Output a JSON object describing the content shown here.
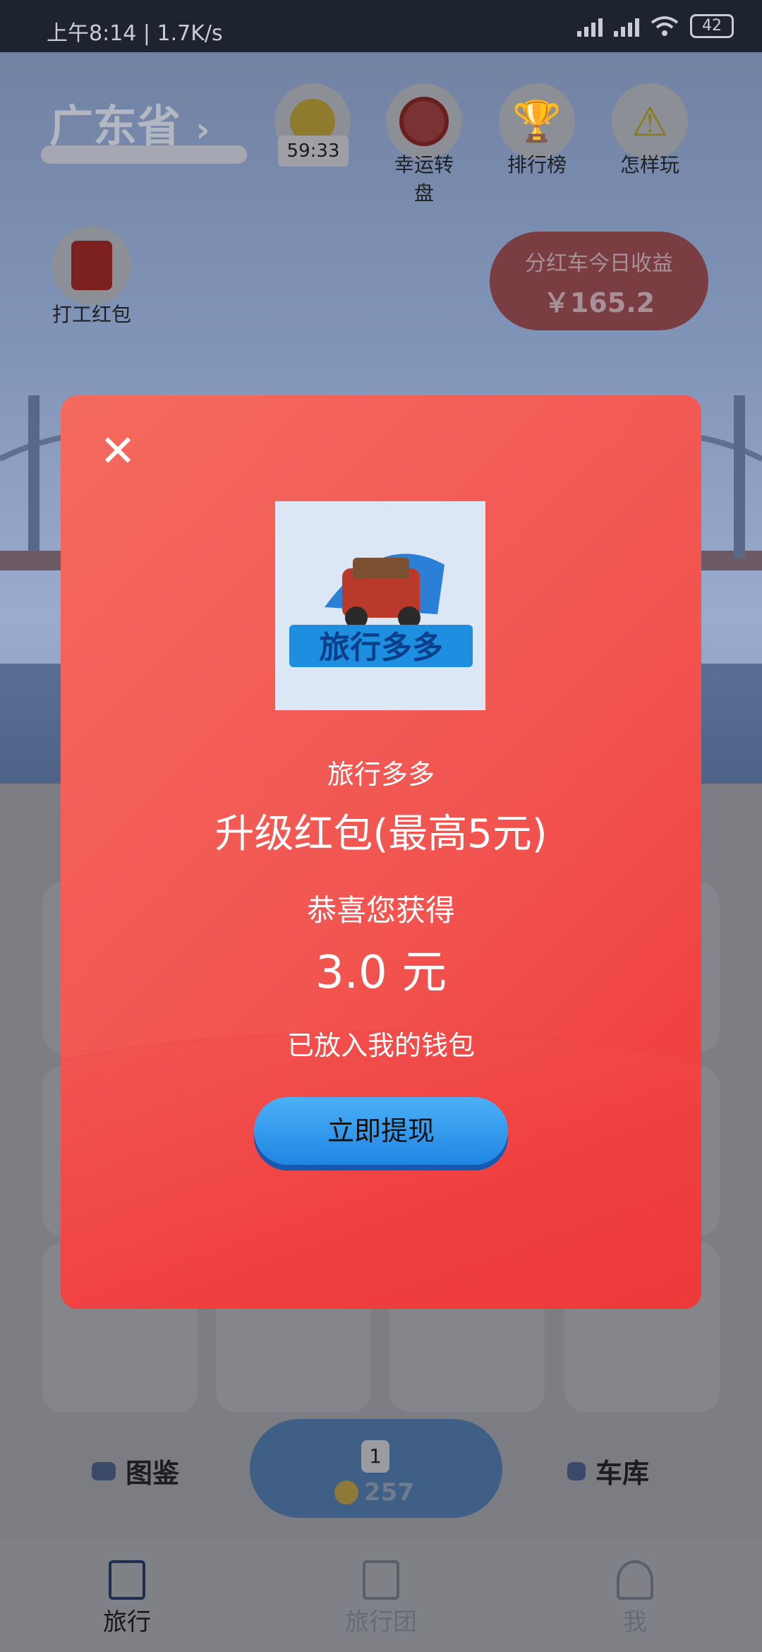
{
  "status_bar": {
    "time": "上午8:14 | 1.7K/s",
    "battery": "42"
  },
  "top_bar": {
    "province": "广东省",
    "timer": "59:33",
    "lucky_wheel_label": "幸运转盘",
    "leaderboard_label": "排行榜",
    "how_to_play_label": "怎样玩"
  },
  "side": {
    "work_redpacket_label": "打工红包",
    "earnings_title": "分红车今日收益",
    "earnings_value": "￥165.2"
  },
  "action_bar": {
    "gallery_label": "图鉴",
    "garage_label": "车库",
    "car_count": "1",
    "buy_price": "257"
  },
  "bottom_nav": {
    "items": [
      {
        "label": "旅行"
      },
      {
        "label": "旅行团"
      },
      {
        "label": "我"
      }
    ]
  },
  "modal": {
    "close_icon": "close-icon",
    "app_name": "旅行多多",
    "reward_title": "升级红包(最高5元)",
    "congrats": "恭喜您获得",
    "amount": "3.0 元",
    "wallet_note": "已放入我的钱包",
    "withdraw_label": "立即提现"
  }
}
